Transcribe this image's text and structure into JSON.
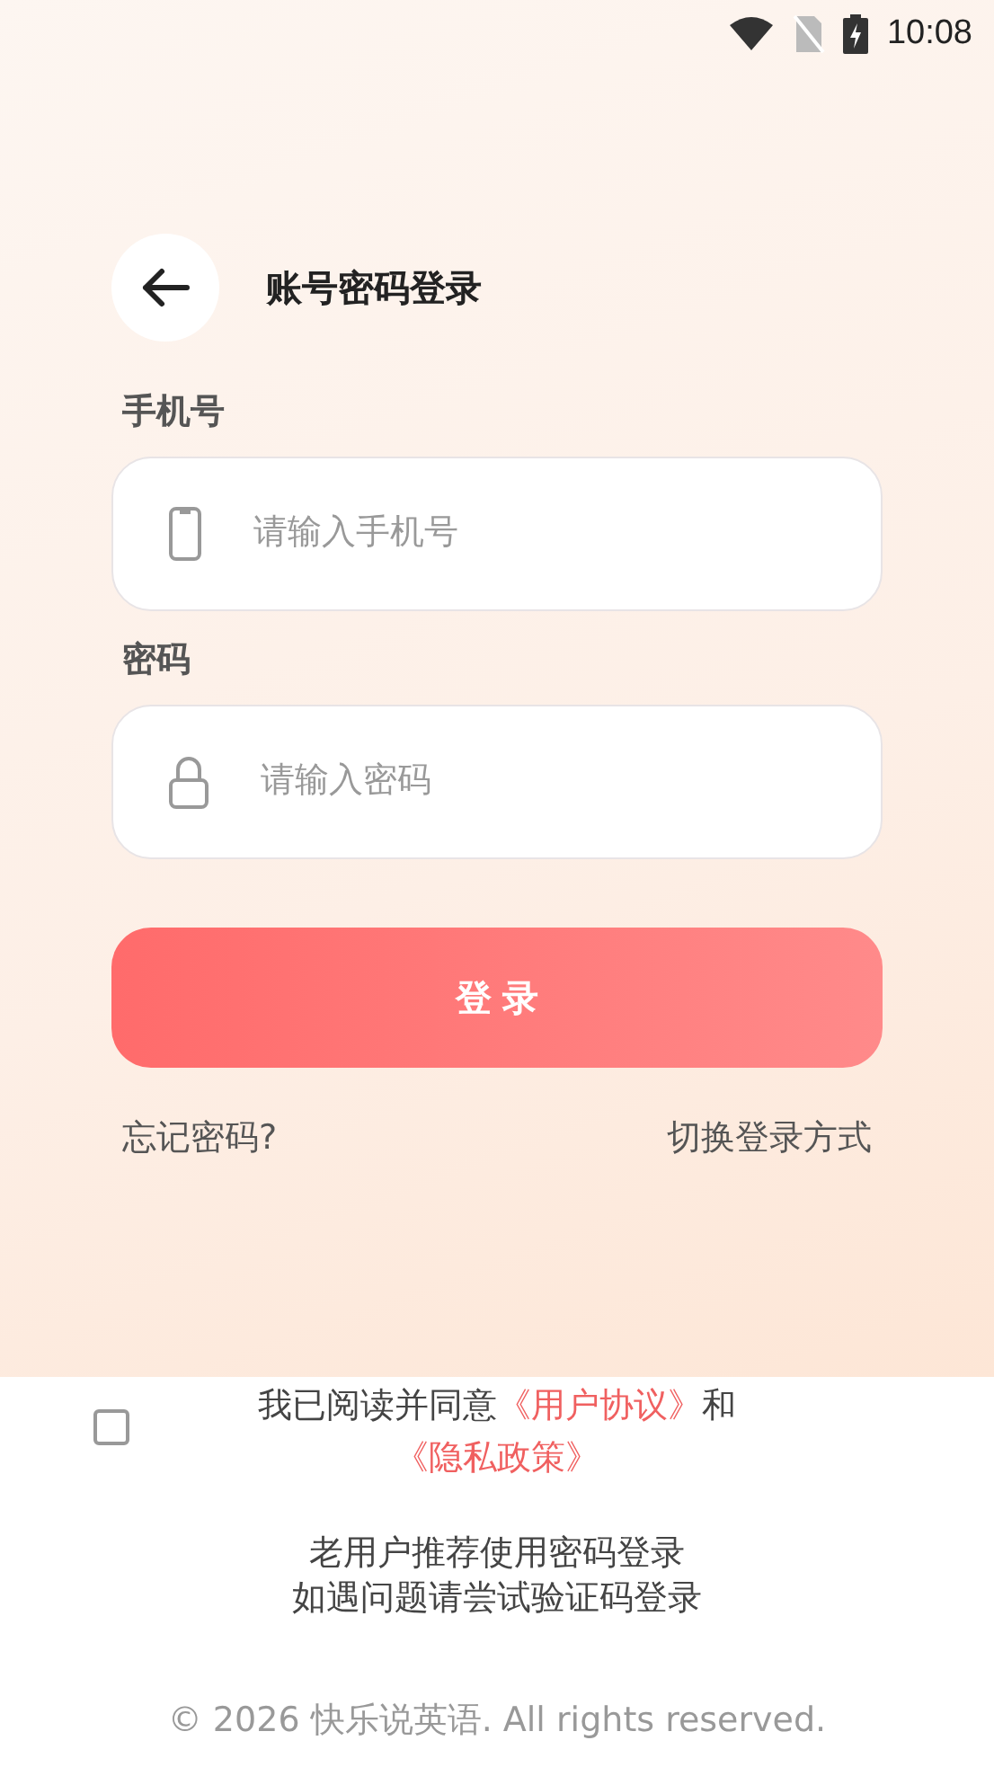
{
  "status_bar": {
    "time": "10:08"
  },
  "header": {
    "title": "账号密码登录"
  },
  "fields": [
    {
      "label": "手机号",
      "placeholder": "请输入手机号",
      "kind": "phone"
    },
    {
      "label": "密码",
      "placeholder": "请输入密码",
      "kind": "password"
    }
  ],
  "login_button": "登 录",
  "links": {
    "forgot": "忘记密码?",
    "switch": "切换登录方式"
  },
  "agreement": {
    "checked": false,
    "prefix": "我已阅读并同意",
    "terms": "《用户协议》",
    "middle": "和",
    "privacy": "《隐私政策》"
  },
  "notes": [
    "老用户推荐使用密码登录",
    "如遇问题请尝试验证码登录"
  ],
  "copyright": "© 2026 快乐说英语. All rights reserved."
}
